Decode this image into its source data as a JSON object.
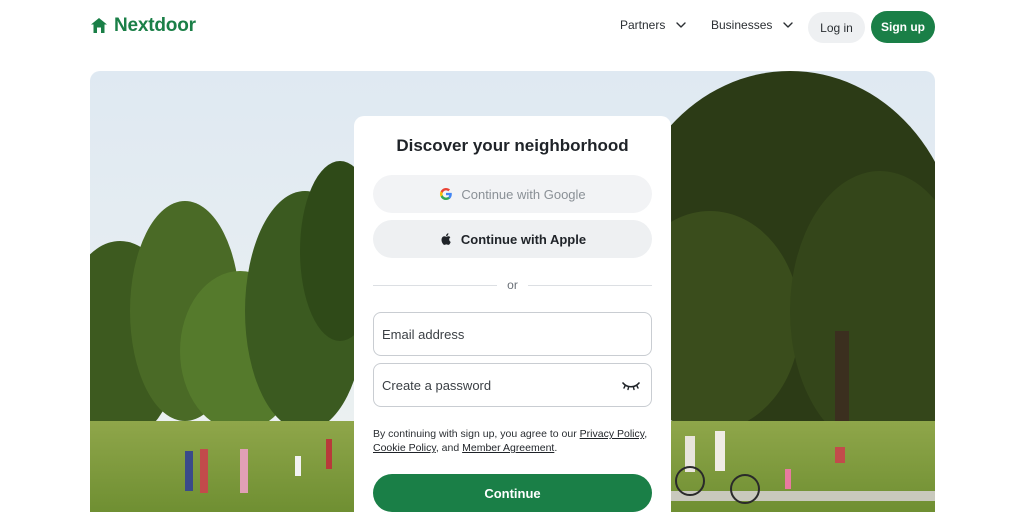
{
  "brand": {
    "name": "Nextdoor",
    "color": "#1a7f47"
  },
  "header": {
    "nav": [
      {
        "label": "Partners",
        "icon": "chevron-down-icon"
      },
      {
        "label": "Businesses",
        "icon": "chevron-down-icon"
      }
    ],
    "login_label": "Log in",
    "signup_label": "Sign up"
  },
  "hero": {
    "image": "park-scene-with-trees-and-people"
  },
  "card": {
    "title": "Discover your neighborhood",
    "google_label": "Continue with Google",
    "apple_label": "Continue with Apple",
    "divider_text": "or",
    "email_placeholder": "Email address",
    "password_placeholder": "Create a password",
    "terms": {
      "prefix": "By continuing with sign up, you agree to our ",
      "privacy": "Privacy Policy",
      "sep1": ", ",
      "cookie": "Cookie Policy",
      "sep2": ", and ",
      "member": "Member Agreement",
      "suffix": "."
    },
    "continue_label": "Continue"
  }
}
